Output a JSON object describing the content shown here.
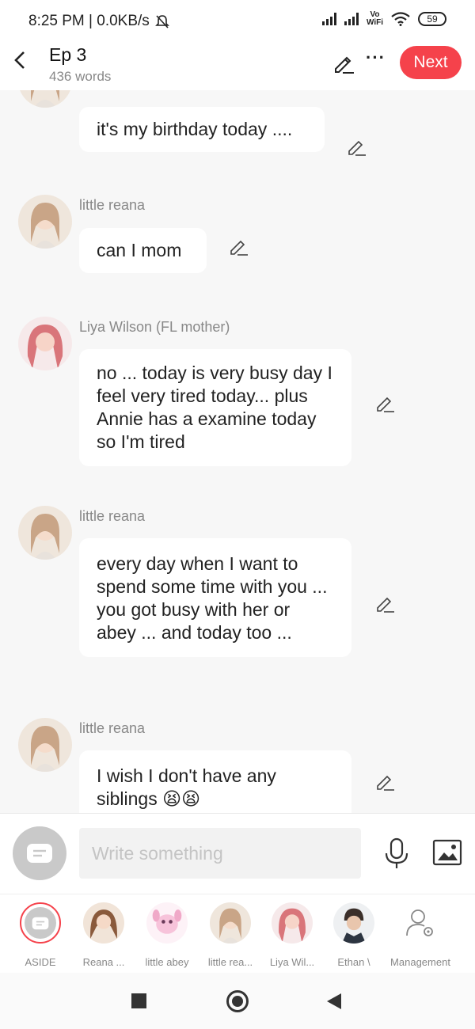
{
  "status": {
    "time_speed": "8:25 PM | 0.0KB/s",
    "vowifi_top": "Vo",
    "vowifi_bottom": "WiFi",
    "battery": "59"
  },
  "header": {
    "title": "Ep 3",
    "subtitle": "436 words",
    "next_label": "Next"
  },
  "messages": [
    {
      "sender": "",
      "text": "it's my birthday today ...."
    },
    {
      "sender": "little reana",
      "text": "can I mom"
    },
    {
      "sender": "Liya Wilson (FL mother)",
      "text": " no ... today is very busy day  I feel very tired today... plus Annie has a examine today so I'm tired"
    },
    {
      "sender": "little reana",
      "text": "every day when I want to spend some time with you ... you got busy with her or abey ... and today too ..."
    },
    {
      "sender": "little reana",
      "text": "I wish I don't have any siblings 😫😫"
    }
  ],
  "input": {
    "placeholder": "Write something"
  },
  "characters": [
    {
      "label": "ASIDE"
    },
    {
      "label": "Reana ..."
    },
    {
      "label": "little abey"
    },
    {
      "label": "little rea..."
    },
    {
      "label": "Liya Wil..."
    },
    {
      "label": "Ethan \\"
    },
    {
      "label": "Management"
    }
  ],
  "colors": {
    "accent": "#f5424b",
    "bubble": "#ffffff",
    "background": "#f7f7f7"
  }
}
